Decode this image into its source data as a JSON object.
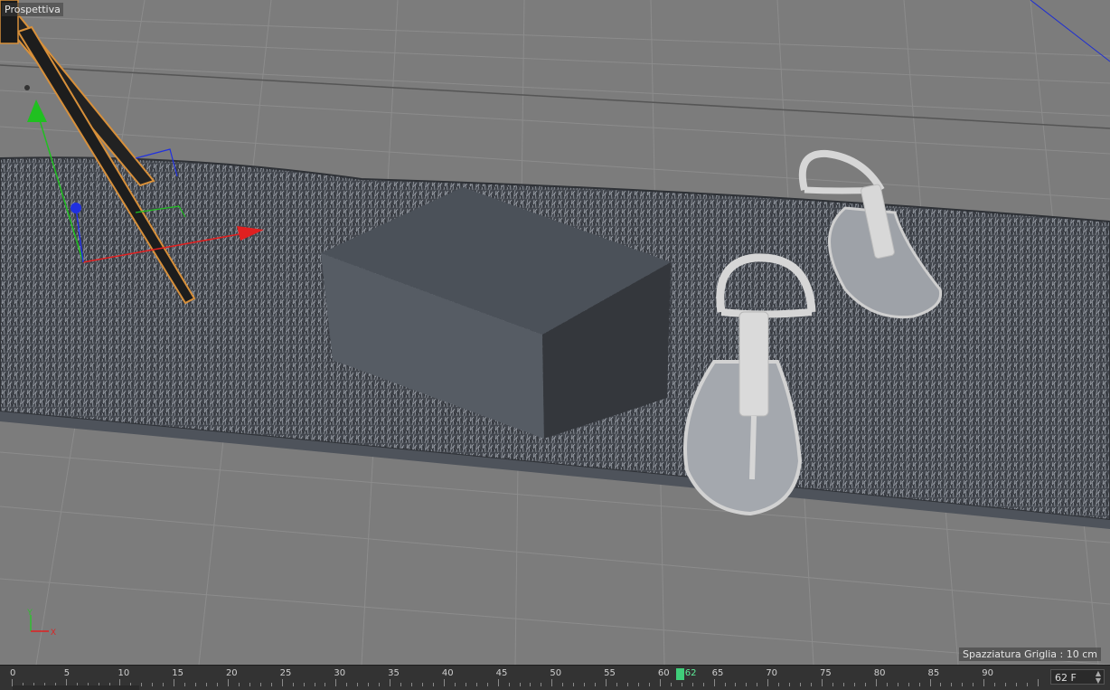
{
  "viewport": {
    "view_name": "Prospettiva",
    "grid_spacing": "Spazziatura Griglia : 10 cm",
    "axis_labels": {
      "y": "Y",
      "x": "X"
    }
  },
  "objects": [
    {
      "name": "camera-object"
    },
    {
      "name": "gray-box"
    },
    {
      "name": "sandal-left"
    },
    {
      "name": "sandal-right"
    },
    {
      "name": "grass-carpet"
    }
  ],
  "timeline": {
    "ticks": [
      "0",
      "5",
      "10",
      "15",
      "20",
      "25",
      "30",
      "35",
      "40",
      "45",
      "50",
      "55",
      "60",
      "62",
      "65",
      "70",
      "75",
      "80",
      "85",
      "90"
    ],
    "current_frame_label": "62",
    "current_frame": 62,
    "max_frame": 90,
    "frame_field": "62 F"
  },
  "colors": {
    "floor": "#7c7c7c",
    "box": "#4c535c",
    "grass": "#3f434a",
    "sandal": "#d0d0d0",
    "x_axis": "#e02020",
    "y_axis": "#20c020",
    "z_axis": "#2030e0",
    "timeline_marker": "#3fcf7a"
  }
}
